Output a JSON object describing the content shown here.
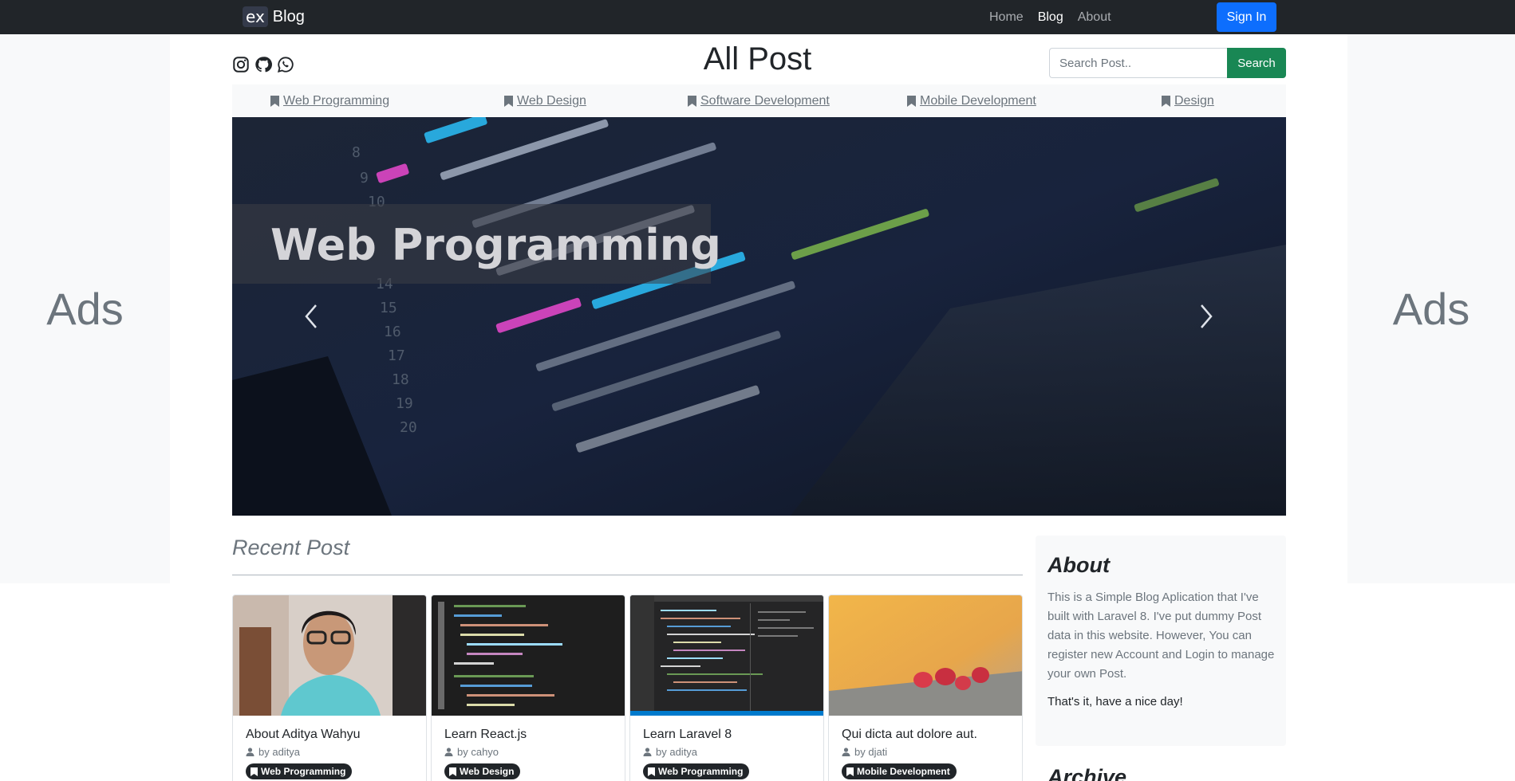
{
  "navbar": {
    "logo": "ex",
    "brand": "Blog",
    "links": [
      "Home",
      "Blog",
      "About"
    ],
    "active": "Blog",
    "signin": "Sign In"
  },
  "ads": {
    "left": "Ads",
    "right": "Ads"
  },
  "header": {
    "title": "All Post",
    "search_placeholder": "Search Post..",
    "search_button": "Search"
  },
  "categories": [
    "Web Programming",
    "Web Design",
    "Software Development",
    "Mobile Development",
    "Design"
  ],
  "carousel": {
    "caption": "Web Programming"
  },
  "recent": {
    "title": "Recent Post",
    "posts": [
      {
        "title": "About Aditya Wahyu",
        "author": "by aditya",
        "category": "Web Programming"
      },
      {
        "title": "Learn React.js",
        "author": "by cahyo",
        "category": "Web Design"
      },
      {
        "title": "Learn Laravel 8",
        "author": "by aditya",
        "category": "Web Programming"
      },
      {
        "title": "Qui dicta aut dolore aut.",
        "author": "by djati",
        "category": "Mobile Development"
      }
    ]
  },
  "about": {
    "title": "About",
    "text": "This is a Simple Blog Aplication that I've built with Laravel 8. I've put dummy Post data in this website. However, You can register new Account and Login to manage your own Post.",
    "text2": "That's it, have a nice day!"
  },
  "archive": {
    "title": "Archive"
  },
  "colors": {
    "navbar": "#212529",
    "primary": "#0d6efd",
    "success": "#198754"
  }
}
